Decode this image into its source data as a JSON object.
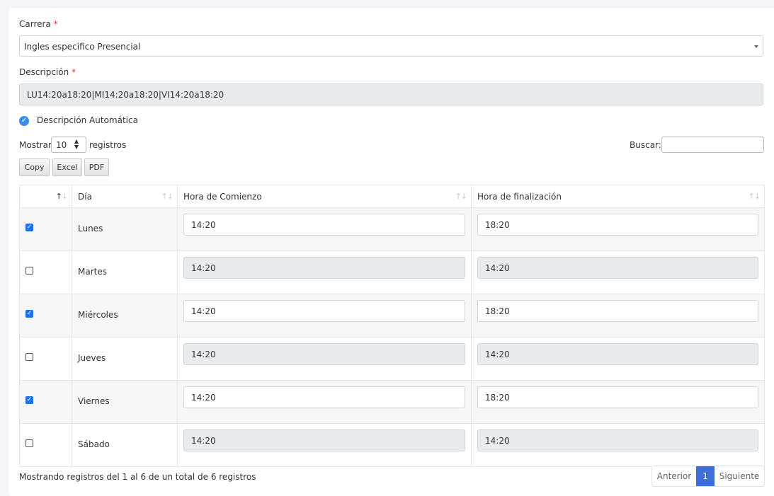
{
  "form": {
    "carrera_label": "Carrera",
    "required_mark": "*",
    "carrera_value": "Ingles especifico Presencial",
    "descripcion_label": "Descripción",
    "descripcion_value": "LU14:20a18:20|MI14:20a18:20|VI14:20a18:20",
    "auto_desc_label": "Descripción Automática",
    "auto_desc_checked": true
  },
  "table_controls": {
    "show_label": "Mostrar",
    "page_length": "10",
    "records_label": "registros",
    "search_label": "Buscar:",
    "search_value": "",
    "buttons": [
      "Copy",
      "Excel",
      "PDF"
    ]
  },
  "table": {
    "columns": [
      "",
      "Día",
      "Hora de Comienzo",
      "Hora de finalización"
    ],
    "rows": [
      {
        "checked": true,
        "day": "Lunes",
        "start": "14:20",
        "end": "18:20"
      },
      {
        "checked": false,
        "day": "Martes",
        "start": "14:20",
        "end": "14:20"
      },
      {
        "checked": true,
        "day": "Miércoles",
        "start": "14:20",
        "end": "18:20"
      },
      {
        "checked": false,
        "day": "Jueves",
        "start": "14:20",
        "end": "14:20"
      },
      {
        "checked": true,
        "day": "Viernes",
        "start": "14:20",
        "end": "18:20"
      },
      {
        "checked": false,
        "day": "Sábado",
        "start": "14:20",
        "end": "14:20"
      }
    ]
  },
  "footer": {
    "info": "Mostrando registros del 1 al 6 de un total de 6 registros",
    "prev": "Anterior",
    "page": "1",
    "next": "Siguiente"
  },
  "colors": {
    "accent": "#3e6fd8",
    "checkbox": "#1a73e8",
    "readonly_bg": "#e9ecef",
    "required": "#e3342f"
  }
}
